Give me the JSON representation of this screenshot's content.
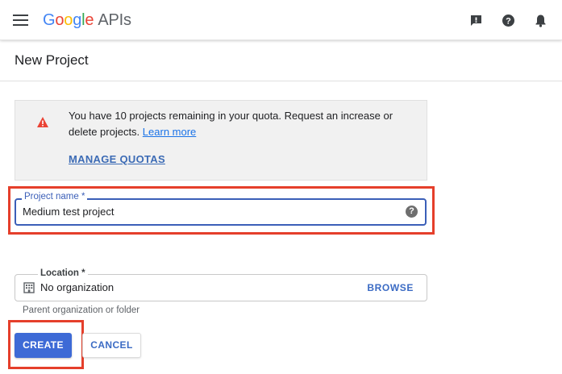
{
  "header": {
    "menu_icon": "hamburger-menu-icon",
    "logo": {
      "letters": [
        "G",
        "o",
        "o",
        "g",
        "l",
        "e"
      ],
      "product": "APIs"
    },
    "icons": [
      "feedback-icon",
      "help-icon",
      "notifications-icon"
    ]
  },
  "page": {
    "title": "New Project"
  },
  "quota_notice": {
    "icon": "warning-icon",
    "message": "You have 10 projects remaining in your quota. Request an increase or delete projects.",
    "learn_more": "Learn more",
    "manage_quotas": "MANAGE QUOTAS"
  },
  "project_name": {
    "label": "Project name *",
    "value": "Medium test project",
    "help_icon": "help-icon"
  },
  "location": {
    "label": "Location *",
    "value": "No organization",
    "icon": "building-icon",
    "browse": "BROWSE",
    "hint": "Parent organization or folder"
  },
  "actions": {
    "create": "CREATE",
    "cancel": "CANCEL"
  },
  "colors": {
    "primary": "#3d6ad6",
    "link": "#1a73e8",
    "highlight": "#e53f2b",
    "warning": "#ea4335"
  }
}
